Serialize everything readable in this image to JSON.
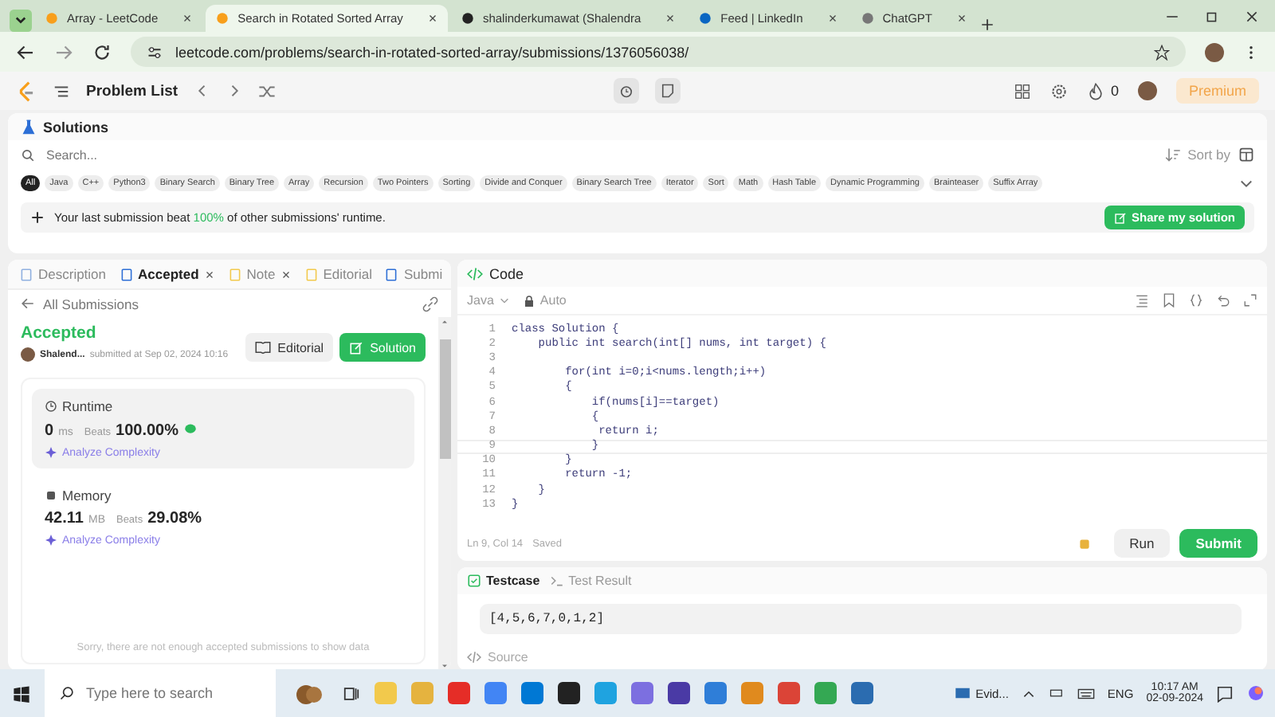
{
  "browser": {
    "tabs": [
      {
        "title": "Array - LeetCode",
        "selected": false
      },
      {
        "title": "Search in Rotated Sorted Array",
        "selected": true
      },
      {
        "title": "shalinderkumawat (Shalendra",
        "selected": false
      },
      {
        "title": "Feed | LinkedIn",
        "selected": false
      },
      {
        "title": "ChatGPT",
        "selected": false
      }
    ],
    "url": "leetcode.com/problems/search-in-rotated-sorted-array/submissions/1376056038/"
  },
  "lc_header": {
    "title": "Problem List",
    "streak": "0",
    "premium": "Premium"
  },
  "solutions": {
    "title": "Solutions",
    "search_placeholder": "Search...",
    "sort": "Sort by",
    "tags": [
      {
        "label": "All",
        "selected": true
      },
      {
        "label": "Java",
        "selected": false
      },
      {
        "label": "C++",
        "selected": false
      },
      {
        "label": "Python3",
        "selected": false
      },
      {
        "label": "Binary Search",
        "selected": false
      },
      {
        "label": "Binary Tree",
        "selected": false
      },
      {
        "label": "Array",
        "selected": false
      },
      {
        "label": "Recursion",
        "selected": false
      },
      {
        "label": "Two Pointers",
        "selected": false
      },
      {
        "label": "Sorting",
        "selected": false
      },
      {
        "label": "Divide and Conquer",
        "selected": false
      },
      {
        "label": "Binary Search Tree",
        "selected": false
      },
      {
        "label": "Iterator",
        "selected": false
      },
      {
        "label": "Sort",
        "selected": false
      },
      {
        "label": "Math",
        "selected": false
      },
      {
        "label": "Hash Table",
        "selected": false
      },
      {
        "label": "Dynamic Programming",
        "selected": false
      },
      {
        "label": "Brainteaser",
        "selected": false
      },
      {
        "label": "Suffix Array",
        "selected": false
      }
    ],
    "banner": {
      "before": "Your last submission beat ",
      "highlight": "100%",
      "after": " of other submissions' runtime."
    },
    "share": "Share my solution"
  },
  "left_panel": {
    "tabs": [
      {
        "label": "Description",
        "selected": false,
        "closable": false
      },
      {
        "label": "Accepted",
        "selected": true,
        "closable": true
      },
      {
        "label": "Note",
        "selected": false,
        "closable": true
      },
      {
        "label": "Editorial",
        "selected": false,
        "closable": false
      },
      {
        "label": "Submi",
        "selected": false,
        "closable": false
      }
    ],
    "back": "All Submissions",
    "status": "Accepted",
    "author": "Shalend...",
    "submitted": "submitted at Sep 02, 2024 10:16",
    "editorial": "Editorial",
    "solution": "Solution",
    "stats": [
      {
        "kind": "runtime",
        "title": "Runtime",
        "value": "0",
        "unit": "ms",
        "beats_label": "Beats",
        "beats": "100.00%",
        "analyze": "Analyze Complexity",
        "selected": true
      },
      {
        "kind": "memory",
        "title": "Memory",
        "value": "42.11",
        "unit": "MB",
        "beats_label": "Beats",
        "beats": "29.08%",
        "analyze": "Analyze Complexity",
        "selected": false
      }
    ],
    "note": "Sorry, there are not enough accepted submissions to show data"
  },
  "code_panel": {
    "title": "Code",
    "language": "Java",
    "mode": "Auto",
    "lines": [
      {
        "num": "1",
        "text": "class Solution {"
      },
      {
        "num": "2",
        "text": "    public int search(int[] nums, int target) {"
      },
      {
        "num": "3"
      },
      {
        "num": "4",
        "text": "        for(int i=0;i<nums.length;i++)"
      },
      {
        "num": "5",
        "text": "        {"
      },
      {
        "num": "6",
        "text": "            if(nums[i]==target)"
      },
      {
        "num": "7",
        "text": "            {"
      },
      {
        "num": "8",
        "text": "             return i;"
      },
      {
        "num": "9",
        "text": "            }"
      },
      {
        "num": "10",
        "text": "        }"
      },
      {
        "num": "11",
        "text": "        return -1;"
      },
      {
        "num": "12",
        "text": "    }"
      },
      {
        "num": "13",
        "text": "}"
      }
    ],
    "cursor": "Ln 9, Col 14",
    "saved": "Saved",
    "run": "Run",
    "submit": "Submit"
  },
  "testcase": {
    "tabs": [
      {
        "label": "Testcase",
        "selected": true
      },
      {
        "label": "Test Result",
        "selected": false
      }
    ],
    "input": "[4,5,6,7,0,1,2]",
    "source": "Source"
  },
  "taskbar": {
    "search_placeholder": "Type here to search",
    "pinned": "Evid...",
    "lang": "ENG",
    "time": "10:17 AM",
    "date": "02-09-2024"
  }
}
